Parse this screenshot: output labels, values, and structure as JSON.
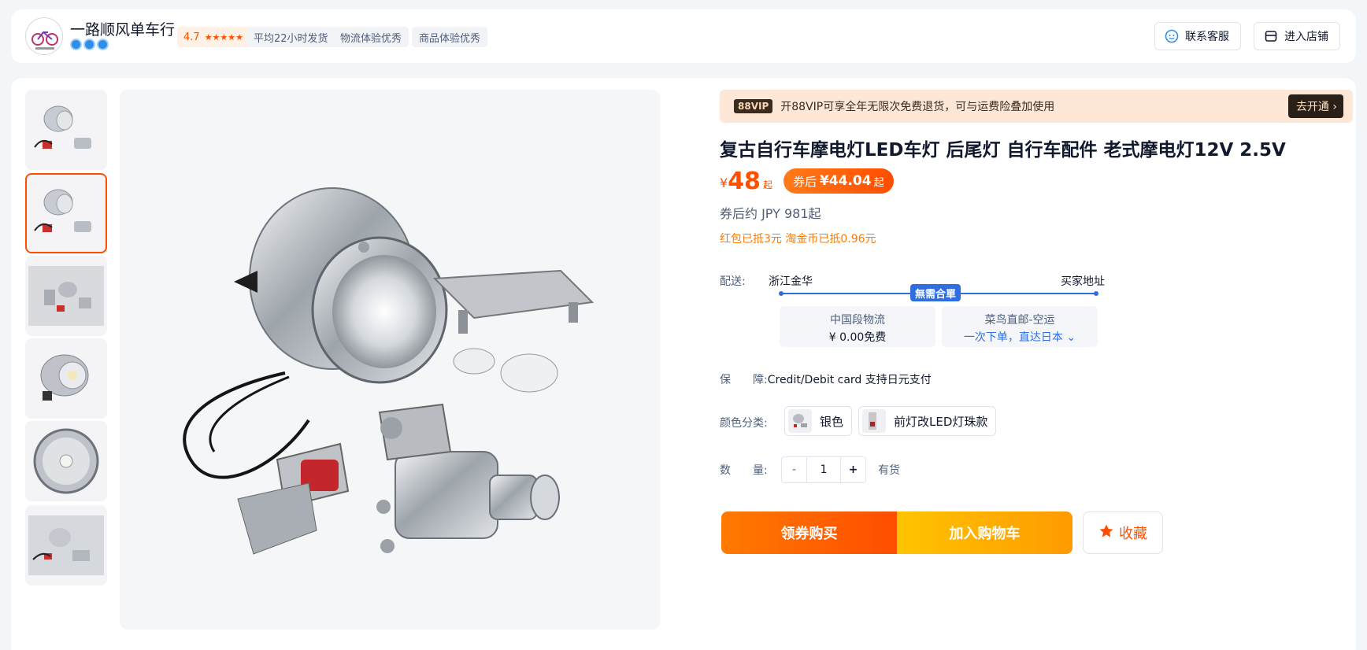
{
  "shop": {
    "name": "一路顺风单车行",
    "rating": "4.7",
    "stars_count": 5,
    "tags": [
      "平均22小时发货",
      "物流体验优秀",
      "商品体验优秀"
    ],
    "contact_label": "联系客服",
    "enter_shop_label": "进入店铺"
  },
  "vip": {
    "logo": "88VIP",
    "text": "开88VIP可享全年无限次免费退货，可与运费险叠加使用",
    "button": "去开通"
  },
  "product": {
    "title": "复古自行车摩电灯LED车灯 后尾灯 自行车配件 老式摩电灯12V 2.5V",
    "price_symbol": "¥",
    "price": "48",
    "price_suffix": "起",
    "coupon_prefix": "券后",
    "coupon_price": "¥44.04",
    "coupon_suffix": "起",
    "jpy_text": "券后约 JPY 981起",
    "discount_text": "红包已抵3元 淘金币已抵0.96元"
  },
  "shipping": {
    "label": "配送:",
    "from": "浙江金华",
    "to": "买家地址",
    "badge": "無需合單",
    "options": [
      {
        "line1": "中国段物流",
        "line2": "¥ 0.00免费"
      },
      {
        "line1": "菜鸟直邮-空运",
        "line2": "一次下单，直达日本"
      }
    ]
  },
  "guarantee": {
    "label": "保　　障:",
    "value": "Credit/Debit card 支持日元支付"
  },
  "sku": {
    "label": "颜色分类:",
    "options": [
      "银色",
      "前灯改LED灯珠款"
    ]
  },
  "quantity": {
    "label": "数　　量:",
    "minus": "-",
    "value": "1",
    "plus": "+",
    "stock": "有货"
  },
  "actions": {
    "coupon_buy": "领券购买",
    "add_cart": "加入购物车",
    "favorite": "收藏"
  },
  "colors": {
    "accent": "#ff5000",
    "blue": "#2f6ee0"
  }
}
